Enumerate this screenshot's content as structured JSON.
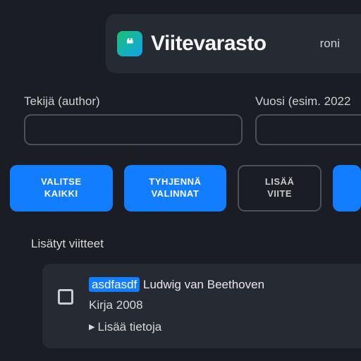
{
  "header": {
    "brand": "Viitevarasto",
    "logo_glyph": "❝",
    "user": "roni"
  },
  "filters": {
    "author": {
      "label": "Tekijä (author)",
      "value": ""
    },
    "year": {
      "label": "Vuosi (esim. 2022",
      "value": ""
    }
  },
  "buttons": {
    "select_all": "VALITSE\nKAIKKI",
    "clear": "TYHJENNÄ\nVALINNAT",
    "add": "LISÄÄ\nVIITE"
  },
  "section": {
    "title": "Lisätyt viitteet"
  },
  "reference": {
    "key": "asdfasdf",
    "author": "Ludwig van Beethoven",
    "type": "Kirja",
    "year": "2008",
    "expand": "Lisää tietoja"
  }
}
